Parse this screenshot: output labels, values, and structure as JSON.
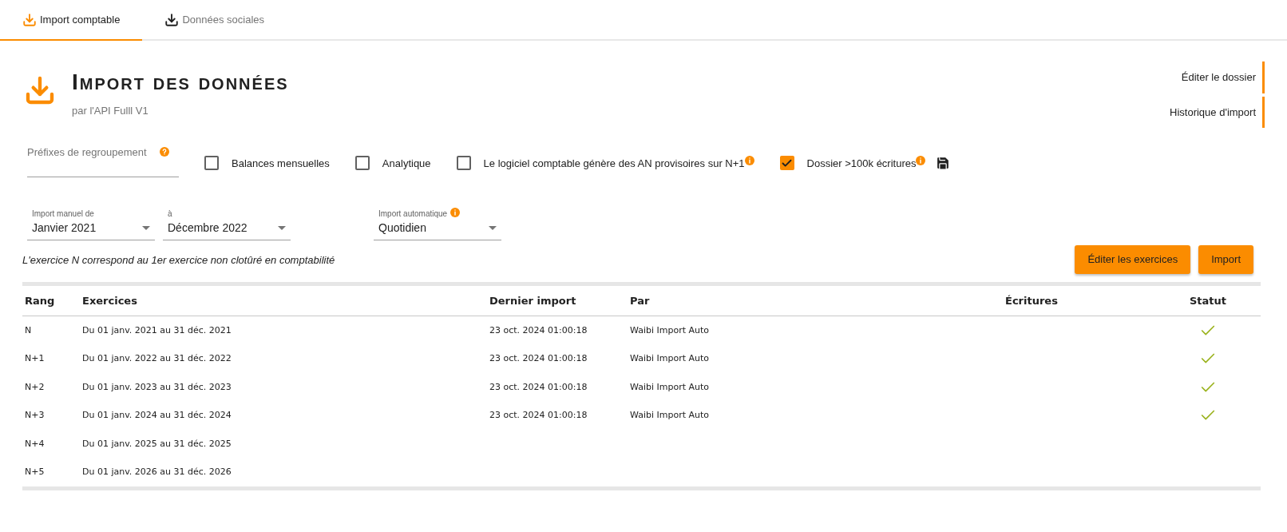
{
  "tabs": [
    {
      "label": "Import comptable",
      "selected": true
    },
    {
      "label": "Données sociales",
      "selected": false
    }
  ],
  "header": {
    "title": "Import des données",
    "subtitle": "par l'API Fulll V1"
  },
  "side_links": [
    "Éditer le dossier",
    "Historique d'import"
  ],
  "prefix_field": {
    "placeholder": "Préfixes de regroupement"
  },
  "options": [
    {
      "label": "Balances mensuelles",
      "checked": false,
      "info": false
    },
    {
      "label": "Analytique",
      "checked": false,
      "info": false
    },
    {
      "label": "Le logiciel comptable génère des AN provisoires sur N+1",
      "checked": false,
      "info": true
    },
    {
      "label": "Dossier >100k écritures",
      "checked": true,
      "info": true
    }
  ],
  "selects": [
    {
      "label": "Import manuel de",
      "value": "Janvier 2021",
      "info": false
    },
    {
      "label": "à",
      "value": "Décembre 2022",
      "info": false
    },
    {
      "label": "Import automatique",
      "value": "Quotidien",
      "info": true
    }
  ],
  "note": "L'exercice N correspond au 1er exercice non clotûré en comptabilité",
  "buttons": [
    "Éditer les exercices",
    "Import"
  ],
  "table": {
    "columns": [
      "Rang",
      "Exercices",
      "Dernier import",
      "Par",
      "Écritures",
      "Statut"
    ],
    "rows": [
      {
        "rang": "N",
        "exercice": "Du 01 janv. 2021 au 31 déc. 2021",
        "dernier_import": "23 oct. 2024 01:00:18",
        "par": "Waibi Import Auto",
        "ok": true
      },
      {
        "rang": "N+1",
        "exercice": "Du 01 janv. 2022 au 31 déc. 2022",
        "dernier_import": "23 oct. 2024 01:00:18",
        "par": "Waibi Import Auto",
        "ok": true
      },
      {
        "rang": "N+2",
        "exercice": "Du 01 janv. 2023 au 31 déc. 2023",
        "dernier_import": "23 oct. 2024 01:00:18",
        "par": "Waibi Import Auto",
        "ok": true
      },
      {
        "rang": "N+3",
        "exercice": "Du 01 janv. 2024 au 31 déc. 2024",
        "dernier_import": "23 oct. 2024 01:00:18",
        "par": "Waibi Import Auto",
        "ok": true
      },
      {
        "rang": "N+4",
        "exercice": "Du 01 janv. 2025 au 31 déc. 2025",
        "ok": false
      },
      {
        "rang": "N+5",
        "exercice": "Du 01 janv. 2026 au 31 déc. 2026",
        "ok": false
      }
    ]
  }
}
